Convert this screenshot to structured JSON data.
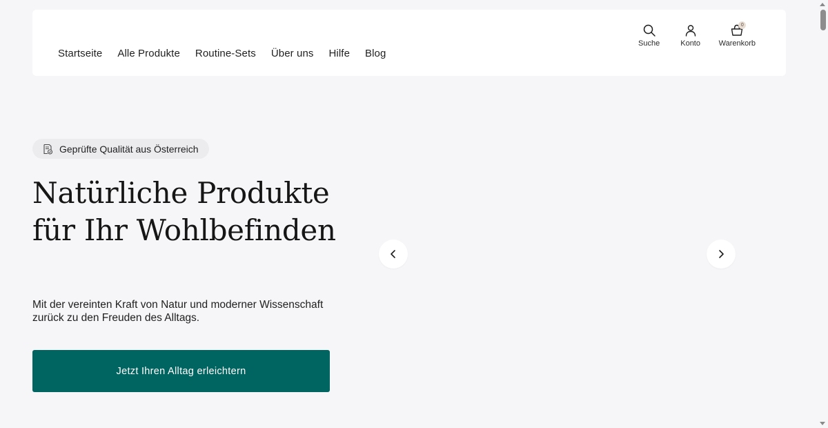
{
  "header": {
    "nav": [
      {
        "label": "Startseite"
      },
      {
        "label": "Alle Produkte"
      },
      {
        "label": "Routine-Sets"
      },
      {
        "label": "Über uns"
      },
      {
        "label": "Hilfe"
      },
      {
        "label": "Blog"
      }
    ],
    "actions": {
      "search": {
        "label": "Suche",
        "icon": "search-icon"
      },
      "account": {
        "label": "Konto",
        "icon": "user-icon"
      },
      "cart": {
        "label": "Warenkorb",
        "icon": "shopping-basket-icon",
        "count": "0"
      }
    }
  },
  "hero": {
    "badge": {
      "icon": "certificate-check-icon",
      "text": "Geprüfte Qualität aus Österreich"
    },
    "title": "Natürliche Produkte für Ihr Wohlbefinden",
    "subtitle": "Mit der vereinten Kraft von Natur und moderner Wissenschaft zurück zu den Freuden des Alltags.",
    "cta": "Jetzt Ihren Alltag erleichtern"
  },
  "carousel": {
    "prev_icon": "chevron-left-icon",
    "next_icon": "chevron-right-icon"
  },
  "colors": {
    "background": "#f6f6f8",
    "cta": "#006560",
    "cart_badge": "#e9ded4"
  }
}
